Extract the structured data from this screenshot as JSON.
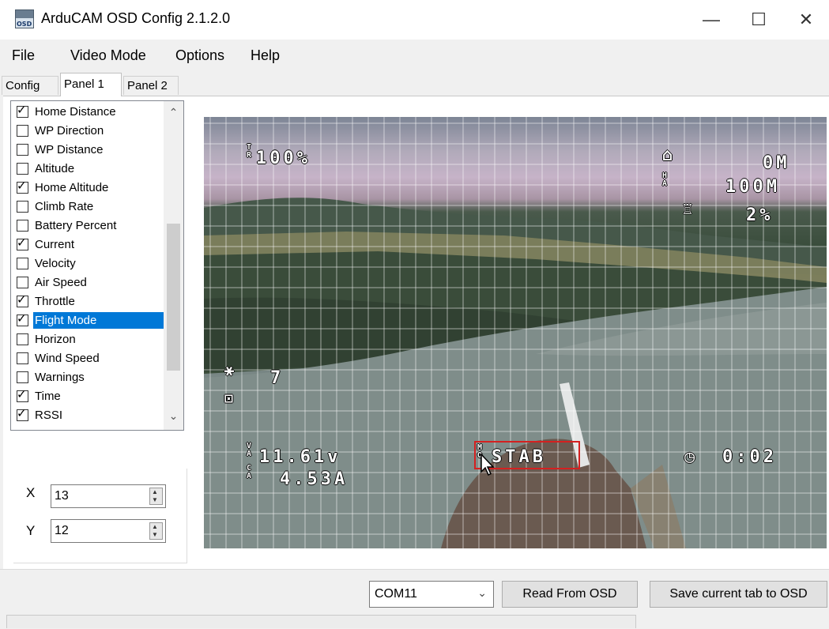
{
  "window": {
    "title": "ArduCAM OSD Config 2.1.2.0",
    "icon_text": "OSD",
    "minimize": "—",
    "maximize": "☐",
    "close": "✕"
  },
  "menu": [
    "File",
    "Video Mode",
    "Options",
    "Help"
  ],
  "tabs": [
    "Config",
    "Panel 1",
    "Panel 2"
  ],
  "active_tab": "Panel 1",
  "panel_list": {
    "items": [
      {
        "label": "Home Distance",
        "checked": true
      },
      {
        "label": "WP Direction",
        "checked": false
      },
      {
        "label": "WP Distance",
        "checked": false
      },
      {
        "label": "Altitude",
        "checked": false
      },
      {
        "label": "Home Altitude",
        "checked": true
      },
      {
        "label": "Climb Rate",
        "checked": false
      },
      {
        "label": "Battery Percent",
        "checked": false
      },
      {
        "label": "Current",
        "checked": true
      },
      {
        "label": "Velocity",
        "checked": false
      },
      {
        "label": "Air Speed",
        "checked": false
      },
      {
        "label": "Throttle",
        "checked": true
      },
      {
        "label": "Flight Mode",
        "checked": true,
        "selected": true
      },
      {
        "label": "Horizon",
        "checked": false
      },
      {
        "label": "Wind Speed",
        "checked": false
      },
      {
        "label": "Warnings",
        "checked": false
      },
      {
        "label": "Time",
        "checked": true
      },
      {
        "label": "RSSI",
        "checked": true
      }
    ],
    "scroll_up": "⌃",
    "scroll_down": "⌄",
    "selection_color": "#0078d7"
  },
  "position": {
    "x_label": "X",
    "x_value": "13",
    "y_label": "Y",
    "y_value": "12"
  },
  "osd": {
    "throttle_icon": "T\nR",
    "throttle": "100%",
    "home_distance": "0M",
    "home_alt_icon": "H\nA",
    "home_altitude": "100M",
    "rssi": "2%",
    "sats": "7",
    "volt_icon": "V\nA",
    "voltage": "11.61v",
    "current_icon": "C\nA",
    "current": "4.53A",
    "mode_icon": "M\nO",
    "flight_mode": "STAB",
    "time": "0:02",
    "highlight_color": "#d42020"
  },
  "bottom": {
    "port": "COM11",
    "read_button": "Read From OSD",
    "save_button": "Save current tab to OSD"
  }
}
